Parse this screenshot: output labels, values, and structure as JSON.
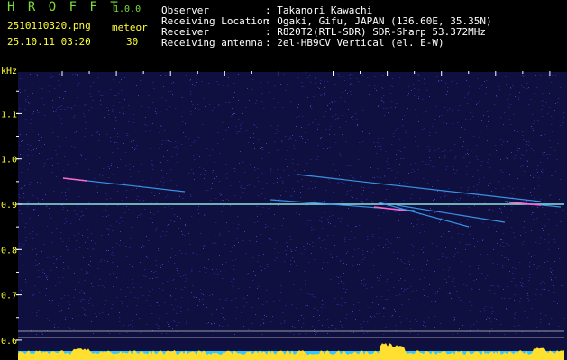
{
  "app": {
    "title": "H R O F F T",
    "version": "1.0.0",
    "filename": "2510110320.png",
    "mode": "meteor",
    "datetime": "25.10.11 03:20",
    "count": "30"
  },
  "info": {
    "labels": [
      "Observer",
      "Receiving Location",
      "Receiver",
      "Receiving antenna"
    ],
    "values": [
      ": Takanori Kawachi",
      ": Ogaki, Gifu, JAPAN (136.60E, 35.35N)",
      ": R820T2(RTL-SDR) SDR-Sharp 53.372MHz",
      ": 2el-HB9CV Vertical (el. E-W)"
    ]
  },
  "spectrogram": {
    "freq_unit": "kHz",
    "time_ticks": [
      "0321",
      "0322",
      "0323",
      "0324",
      "0325",
      "0326",
      "0327",
      "0328",
      "0329",
      "0330"
    ],
    "freq_ticks": [
      "1.1",
      "1.0",
      "0.9",
      "0.8",
      "0.7",
      "0.6"
    ],
    "colors": {
      "background": "#101040",
      "axis_text": "#ffff33",
      "tick": "#ffffff",
      "carrier": "#7fd7ff",
      "power_fill": "#ffe030",
      "power_base": "#33c7ff"
    }
  }
}
